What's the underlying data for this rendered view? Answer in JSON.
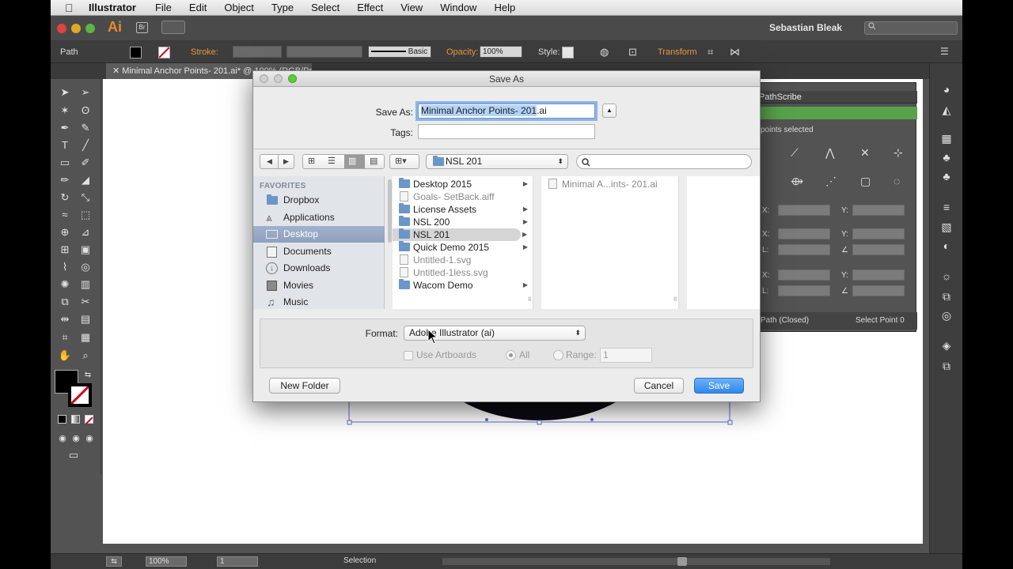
{
  "menubar": {
    "app": "Illustrator",
    "items": [
      "File",
      "Edit",
      "Object",
      "Type",
      "Select",
      "Effect",
      "View",
      "Window",
      "Help"
    ]
  },
  "appbar": {
    "logo": "Ai",
    "bridge": "Br",
    "user": "Sebastian Bleak"
  },
  "control": {
    "path_label": "Path",
    "stroke_label": "Stroke:",
    "brush_label": "Basic",
    "opacity_label": "Opacity:",
    "opacity_value": "100%",
    "style_label": "Style:",
    "transform_label": "Transform"
  },
  "document_tab": "Minimal Anchor Points- 201.ai* @ 100% (RGB/Preview)",
  "pathscribe": {
    "title": "PathScribe",
    "status": "points selected",
    "path_state": "Path (Closed)",
    "select_button": "Select Point 0",
    "x_label": "X:",
    "y_label": "Y:",
    "l_label": "L:"
  },
  "statusbar": {
    "zoom": "100%",
    "artboard": "1",
    "tool": "Selection"
  },
  "dialog": {
    "title": "Save As",
    "save_as_label": "Save As:",
    "filename_base": "Minimal Anchor Points- 201",
    "filename_ext": ".ai",
    "tags_label": "Tags:",
    "location": "NSL 201",
    "search_placeholder": "",
    "favorites_header": "FAVORITES",
    "favorites": [
      {
        "label": "Dropbox",
        "icon": "folder-icon"
      },
      {
        "label": "Applications",
        "icon": "applications-icon"
      },
      {
        "label": "Desktop",
        "icon": "desktop-icon"
      },
      {
        "label": "Documents",
        "icon": "documents-icon"
      },
      {
        "label": "Downloads",
        "icon": "downloads-icon"
      },
      {
        "label": "Movies",
        "icon": "movies-icon"
      },
      {
        "label": "Music",
        "icon": "music-icon"
      }
    ],
    "column1": [
      {
        "label": "Desktop 2015",
        "type": "folder"
      },
      {
        "label": "Goals- SetBack.aiff",
        "type": "file"
      },
      {
        "label": "License Assets",
        "type": "folder"
      },
      {
        "label": "NSL 200",
        "type": "folder"
      },
      {
        "label": "NSL 201",
        "type": "folder"
      },
      {
        "label": "Quick Demo 2015",
        "type": "folder"
      },
      {
        "label": "Untitled-1.svg",
        "type": "file"
      },
      {
        "label": "Untitled-1less.svg",
        "type": "file"
      },
      {
        "label": "Wacom Demo",
        "type": "folder"
      }
    ],
    "column2": [
      {
        "label": "Minimal A...ints- 201.ai",
        "type": "file"
      }
    ],
    "format_label": "Format:",
    "format_value": "Adobe Illustrator (ai)",
    "use_artboards": "Use Artboards",
    "all_label": "All",
    "range_label": "Range:",
    "range_value": "1",
    "new_folder": "New Folder",
    "cancel": "Cancel",
    "save": "Save"
  }
}
